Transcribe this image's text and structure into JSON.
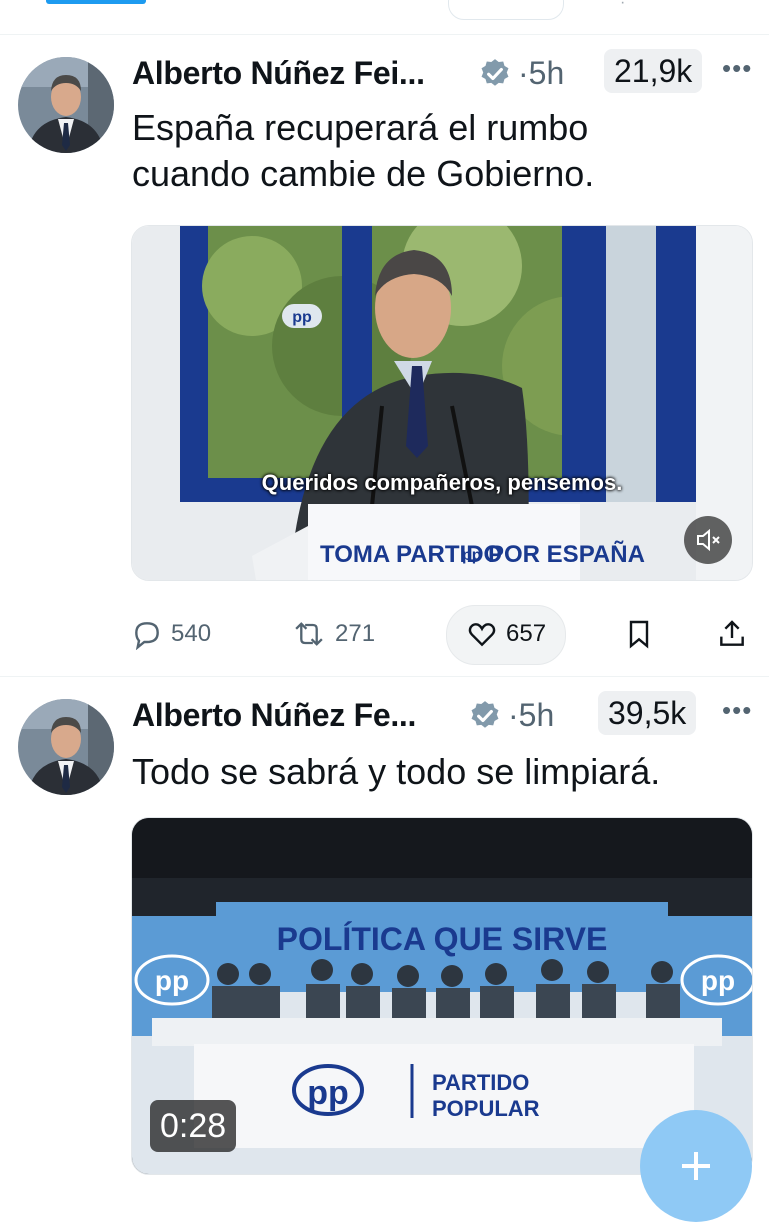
{
  "colors": {
    "accent": "#1d9bf0",
    "verified": "#829aab",
    "text": "#0f1419",
    "muted": "#536471"
  },
  "tweets": [
    {
      "author": "Alberto Núñez Fei...",
      "time": "·5h",
      "views": "21,9k",
      "text_lines": [
        "España recuperará el rumbo",
        "cuando cambie de Gobierno."
      ],
      "media": {
        "type": "video",
        "subtitle": "Queridos compañeros, pensemos.",
        "podium_text": [
          "TOMA PARTIDO",
          "pp",
          "POR ESPAÑA"
        ],
        "logo": "pp",
        "mute_icon": "speaker-muted-icon"
      },
      "replies": "540",
      "retweets": "271",
      "likes": "657"
    },
    {
      "author": "Alberto Núñez Fe...",
      "time": "·5h",
      "views": "39,5k",
      "text_lines": [
        "Todo se sabrá y todo se limpiará."
      ],
      "media": {
        "type": "video",
        "banner": "POLÍTICA QUE SIRVE",
        "side_logo": "pp",
        "table_logo": "pp",
        "table_text": [
          "PARTIDO",
          "POPULAR"
        ],
        "duration": "0:28"
      }
    }
  ],
  "icons": {
    "reply": "reply-icon",
    "retweet": "retweet-icon",
    "like": "heart-icon",
    "bookmark": "bookmark-icon",
    "share": "share-icon",
    "more": "more-icon",
    "compose": "plus-icon"
  }
}
